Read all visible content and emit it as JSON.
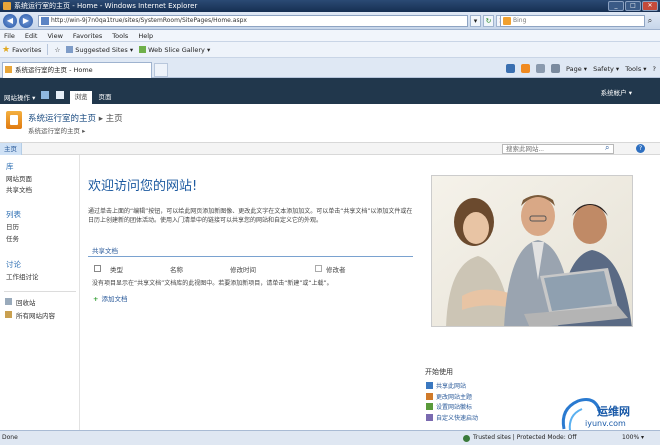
{
  "window": {
    "title": "系统运行室的主页 - Home - Windows Internet Explorer",
    "buttons": [
      "_",
      "□",
      "✕"
    ]
  },
  "address": {
    "url": "http://win-9j7n0qa1true/sites/SystemRoom/SitePages/Home.aspx",
    "search_placeholder": "Bing"
  },
  "menu": [
    "File",
    "Edit",
    "View",
    "Favorites",
    "Tools",
    "Help"
  ],
  "favorites_bar": {
    "favorites_label": "Favorites",
    "suggested": "Suggested Sites ▾",
    "web_slice": "Web Slice Gallery ▾"
  },
  "tab": {
    "label": "系统运行室的主页 - Home"
  },
  "command_bar": {
    "page": "Page ▾",
    "safety": "Safety ▾",
    "tools": "Tools ▾",
    "help": "?"
  },
  "ribbon": {
    "site_actions": "网站操作 ▾",
    "tabs": [
      "浏览",
      "页面"
    ],
    "account": "系统帐户 ▾"
  },
  "site": {
    "title": "系统运行室的主页",
    "breadcrumb": "▸ 主页",
    "subtitle": "系统运行室的主页 ▸"
  },
  "top_nav": {
    "home": "主页",
    "search_placeholder": "搜索此网站...",
    "help": "?"
  },
  "quick_launch": {
    "sections": [
      {
        "heading": "库",
        "items": [
          "网站页面",
          "共享文档"
        ]
      },
      {
        "heading": "列表",
        "items": [
          "日历",
          "任务"
        ]
      },
      {
        "heading": "讨论",
        "items": [
          "工作组讨论"
        ]
      }
    ],
    "bottom": [
      "回收站",
      "所有网站内容"
    ]
  },
  "main": {
    "welcome": "欢迎访问您的网站!",
    "intro": "通过单击上面的“编辑”按钮，可以给此网页添加新图像、更改此文字在文本添加加文。可以单击“共享文档”以添加文件或在日历上创建新的团体活动。使用入门清单中的链接可以共享您的网站和自定义它的外观。",
    "doc_library": {
      "title": "共享文档",
      "columns": [
        "类型",
        "名称",
        "修改时间",
        "修改者"
      ],
      "empty": "没有项目显示在“共享文档”文档库的此视图中。若要添加新项目，请单击“新建”或“上载”。",
      "add": "添加文档"
    }
  },
  "getting_started": {
    "title": "开始使用",
    "items": [
      "共享此网站",
      "更改网站主题",
      "设置网站徽标",
      "自定义快速启动"
    ]
  },
  "watermark": {
    "name": "运维网",
    "url": "iyunv.com"
  },
  "status_bar": {
    "done": "Done",
    "zone": "Trusted sites | Protected Mode: Off",
    "zoom": "100% ▾"
  }
}
